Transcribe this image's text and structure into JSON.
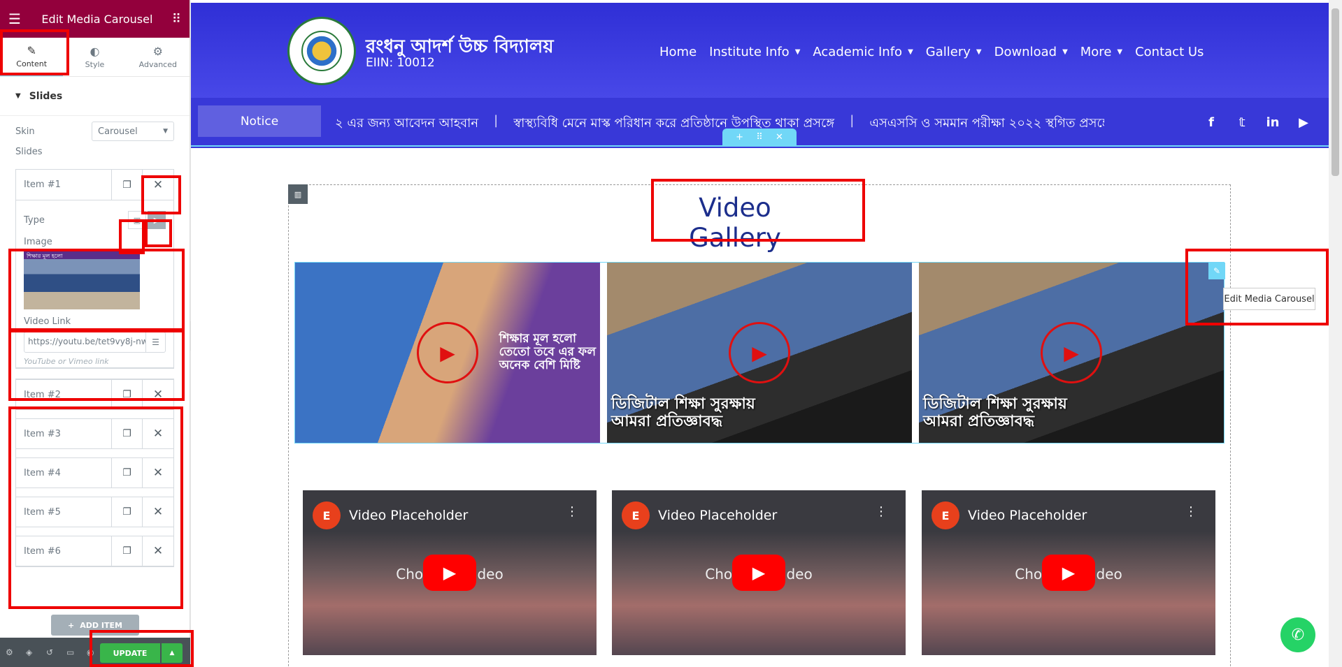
{
  "panel": {
    "title": "Edit Media Carousel",
    "tabs": [
      {
        "label": "Content",
        "icon": "pencil-icon"
      },
      {
        "label": "Style",
        "icon": "contrast-icon"
      },
      {
        "label": "Advanced",
        "icon": "gear-icon"
      }
    ],
    "section_title": "Slides",
    "skin_label": "Skin",
    "skin_value": "Carousel",
    "slides_label": "Slides",
    "items": [
      {
        "label": "Item #1"
      },
      {
        "label": "Item #2"
      },
      {
        "label": "Item #3"
      },
      {
        "label": "Item #4"
      },
      {
        "label": "Item #5"
      },
      {
        "label": "Item #6"
      }
    ],
    "item1": {
      "type_label": "Type",
      "image_label": "Image",
      "thumb_text": "শিক্ষার মূল হলো",
      "video_link_label": "Video Link",
      "video_link_value": "https://youtu.be/tet9vy8j-nw",
      "video_link_hint": "YouTube or Vimeo link"
    },
    "add_item_label": "ADD ITEM",
    "update_label": "UPDATE"
  },
  "site": {
    "school_name": "রংধনু আদর্শ উচ্চ বিদ্যালয়",
    "eiin": "EIIN: 10012",
    "nav": [
      {
        "label": "Home",
        "dropdown": false
      },
      {
        "label": "Institute Info",
        "dropdown": true
      },
      {
        "label": "Academic Info",
        "dropdown": true
      },
      {
        "label": "Gallery",
        "dropdown": true
      },
      {
        "label": "Download",
        "dropdown": true
      },
      {
        "label": "More",
        "dropdown": true
      },
      {
        "label": "Contact Us",
        "dropdown": false
      }
    ],
    "notice_label": "Notice",
    "ticker": [
      "২ এর জন্য আবেদন আহবান",
      "স্বাস্থ্যবিধি মেনে মাস্ক পরিধান করে প্রতিষ্ঠানে উপস্থিত থাকা প্রসঙ্গে",
      "এসএসসি ও সমমান পরীক্ষা ২০২২ স্থগিত প্রসঙ্গে"
    ],
    "socials": [
      "facebook-icon",
      "twitter-icon",
      "linkedin-icon",
      "youtube-icon"
    ]
  },
  "gallery": {
    "title": "Video Gallery",
    "slides": [
      {
        "caption": "শিক্ষার মূল হলো\nতেতো তবে এর ফল\nঅনেক বেশি মিষ্টি"
      },
      {
        "caption": "ডিজিটাল শিক্ষা সুরক্ষায়\nআমরা প্রতিজ্ঞাবদ্ধ"
      },
      {
        "caption": "ডিজিটাল শিক্ষা সুরক্ষায়\nআমরা প্রতিজ্ঞাবদ্ধ"
      }
    ],
    "edit_tooltip": "Edit Media Carousel",
    "placeholders": [
      {
        "title": "Video Placeholder",
        "choose": "Choose a video"
      },
      {
        "title": "Video Placeholder",
        "choose": "Choose a video"
      },
      {
        "title": "Video Placeholder",
        "choose": "Choose a video"
      }
    ]
  },
  "colors": {
    "panel_header": "#93003c",
    "site_header": "#2f2fd6",
    "highlight": "#ee0000",
    "update_button": "#39b54a",
    "gallery_title": "#1c2e8c"
  }
}
